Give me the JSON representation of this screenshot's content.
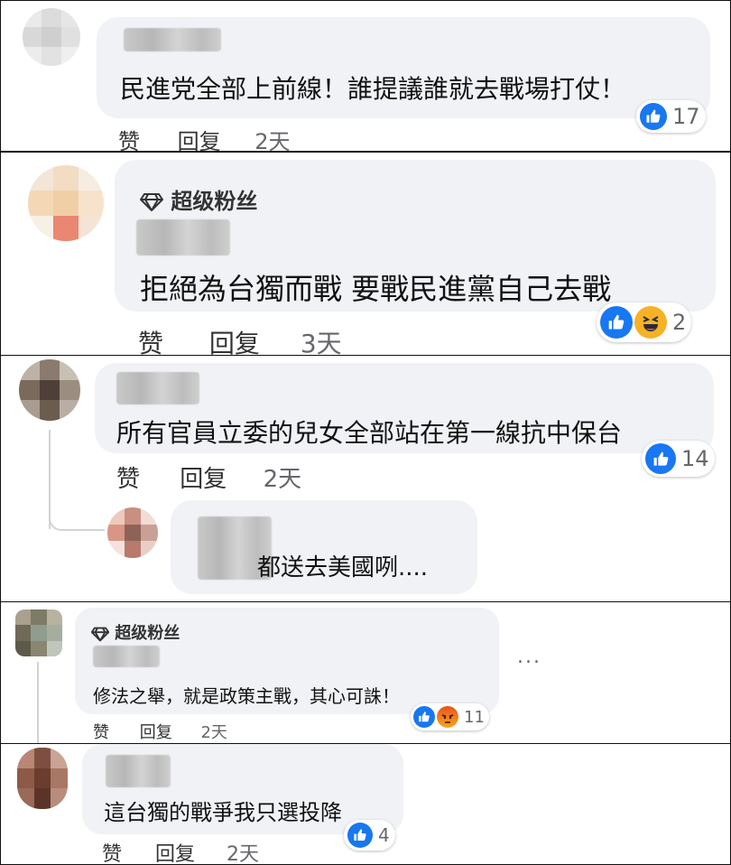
{
  "comments": [
    {
      "text": "民進党全部上前線！誰提議誰就去戰場打仗！",
      "actions": {
        "like": "赞",
        "reply": "回复",
        "time": "2天"
      },
      "reaction_count": "17",
      "reactions": [
        "like-icon"
      ]
    },
    {
      "fan_badge": "超级粉丝",
      "text": "拒絕為台獨而戰 要戰民進黨自己去戰",
      "actions": {
        "like": "赞",
        "reply": "回复",
        "time": "3天"
      },
      "reaction_count": "2",
      "reactions": [
        "like-icon",
        "haha-icon"
      ]
    },
    {
      "text": "所有官員立委的兒女全部站在第一線抗中保台",
      "actions": {
        "like": "赞",
        "reply": "回复",
        "time": "2天"
      },
      "reaction_count": "14",
      "reactions": [
        "like-icon"
      ],
      "reply": {
        "text": "都送去美國咧...."
      }
    },
    {
      "fan_badge": "超级粉丝",
      "text": "修法之舉，就是政策主戰，其心可誅！",
      "actions": {
        "like": "赞",
        "reply": "回复",
        "time": "2天"
      },
      "reaction_count": "11",
      "reactions": [
        "like-icon",
        "angry-icon"
      ],
      "more_menu": "..."
    },
    {
      "text": "這台獨的戰爭我只選投降",
      "actions": {
        "like": "赞",
        "reply": "回复",
        "time": "2天"
      },
      "reaction_count": "4",
      "reactions": [
        "like-icon"
      ]
    }
  ],
  "colors": {
    "bubble": "#f0f2f5",
    "like": "#1877f2",
    "haha": "#f7b125",
    "angry": "#e9541a",
    "meta": "#65676b"
  }
}
